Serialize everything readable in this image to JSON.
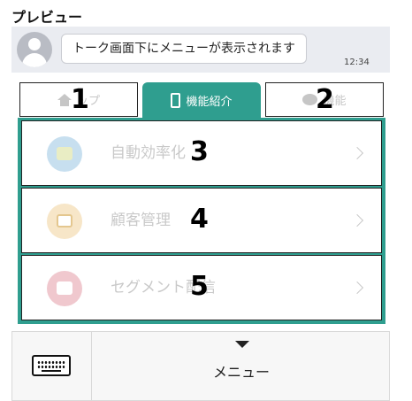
{
  "header": {
    "title": "プレビュー"
  },
  "chat": {
    "message": "トーク画面下にメニューが表示されます",
    "time": "12:34"
  },
  "tabs": [
    {
      "label": "ップ",
      "annotation": "1",
      "icon": "home-icon",
      "active": false
    },
    {
      "label": "機能紹介",
      "icon": "phone-icon",
      "active": true
    },
    {
      "label": "機能",
      "annotation": "2",
      "icon": "chat-icon",
      "active": false
    }
  ],
  "menu_items": [
    {
      "label": "自動効率化",
      "annotation": "3",
      "icon": "automation-icon"
    },
    {
      "label": "顧客管理",
      "annotation": "4",
      "icon": "customer-search-icon"
    },
    {
      "label": "セグメント配信",
      "annotation": "5",
      "icon": "segment-delivery-icon"
    }
  ],
  "footer": {
    "menu_label": "メニュー",
    "keyboard_icon": "keyboard-icon"
  },
  "colors": {
    "accent": "#2f9e8f",
    "disabled_text": "#c9c9c9",
    "chat_bar": "#eaecf1"
  }
}
